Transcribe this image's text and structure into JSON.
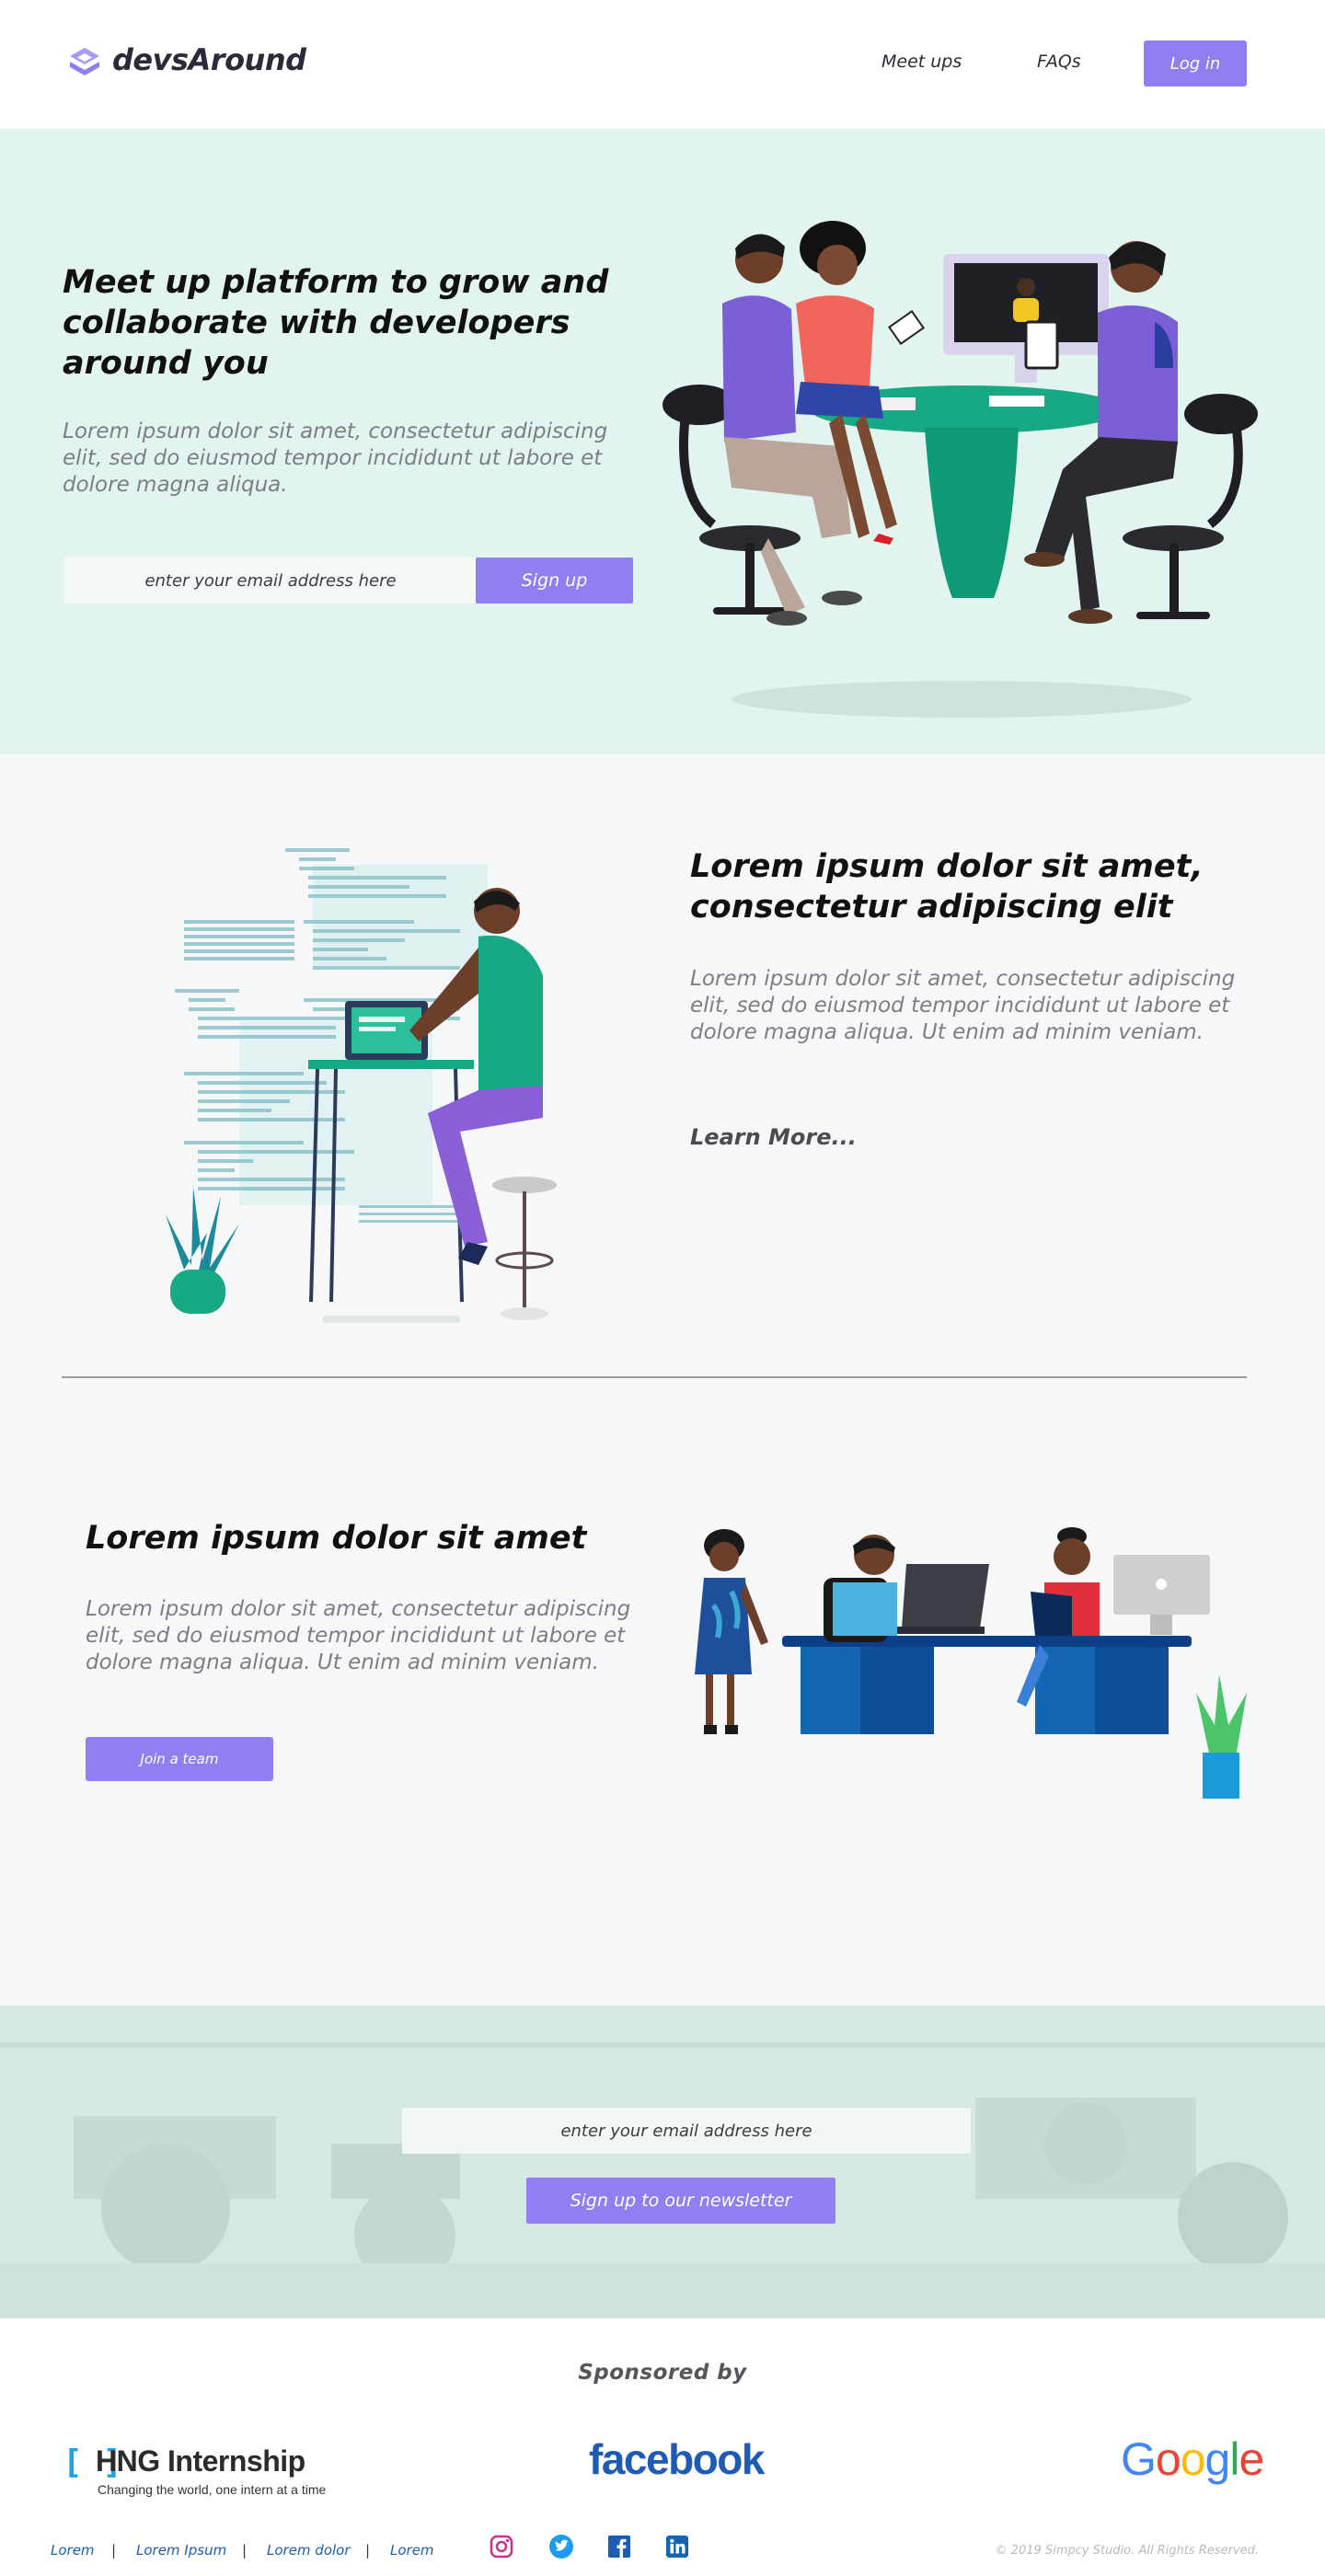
{
  "brand": {
    "name": "devsAround",
    "accent": "#8f7ff0",
    "hero_bg": "#e1f4ef"
  },
  "nav": {
    "items": [
      {
        "label": "Meet ups"
      },
      {
        "label": "FAQs"
      }
    ],
    "login_label": "Log in"
  },
  "hero": {
    "title": "Meet up platform to grow and collaborate with developers around you",
    "subtitle": "Lorem ipsum dolor sit amet, consectetur adipiscing elit, sed do eiusmod tempor incididunt ut labore et dolore magna aliqua.",
    "email_placeholder": "enter your email address here",
    "signup_label": "Sign up",
    "illustration_icon": "team-meeting-illustration"
  },
  "feature_one": {
    "title": "Lorem ipsum dolor sit amet, consectetur adipiscing elit",
    "body": "Lorem ipsum dolor sit amet, consectetur adipiscing elit, sed do eiusmod tempor incididunt ut labore et dolore magna aliqua. Ut enim ad minim veniam.",
    "link_label": "Learn More...",
    "illustration_icon": "developer-coding-illustration"
  },
  "feature_two": {
    "title": "Lorem ipsum dolor sit amet",
    "body": "Lorem ipsum dolor sit amet, consectetur adipiscing elit, sed do eiusmod tempor incididunt ut labore et dolore magna aliqua. Ut enim ad minim veniam.",
    "button_label": "Join a team",
    "illustration_icon": "office-team-illustration"
  },
  "newsletter": {
    "email_placeholder": "enter your email address here",
    "button_label": "Sign up to our newsletter",
    "background_icon": "office-photo-background"
  },
  "sponsors": {
    "heading": "Sponsored  by",
    "hng": {
      "bracket": "[ ]",
      "name": "HNG Internship",
      "tagline": "Changing the world, one intern at a time"
    },
    "facebook": "facebook",
    "google": {
      "letters": [
        "G",
        "o",
        "o",
        "g",
        "l",
        "e"
      ],
      "colors": [
        "#4285f4",
        "#ea4335",
        "#fbbc05",
        "#4285f4",
        "#34a853",
        "#ea4335"
      ]
    }
  },
  "footer": {
    "links": [
      {
        "label": "Lorem"
      },
      {
        "label": "Lorem Ipsum"
      },
      {
        "label": "Lorem dolor"
      },
      {
        "label": "Lorem"
      }
    ],
    "separator": "|",
    "social": [
      {
        "icon": "instagram-icon"
      },
      {
        "icon": "twitter-icon"
      },
      {
        "icon": "facebook-icon"
      },
      {
        "icon": "linkedin-icon"
      }
    ],
    "copyright": "© 2019 Simpcy Studio. All Rights Reserved."
  }
}
